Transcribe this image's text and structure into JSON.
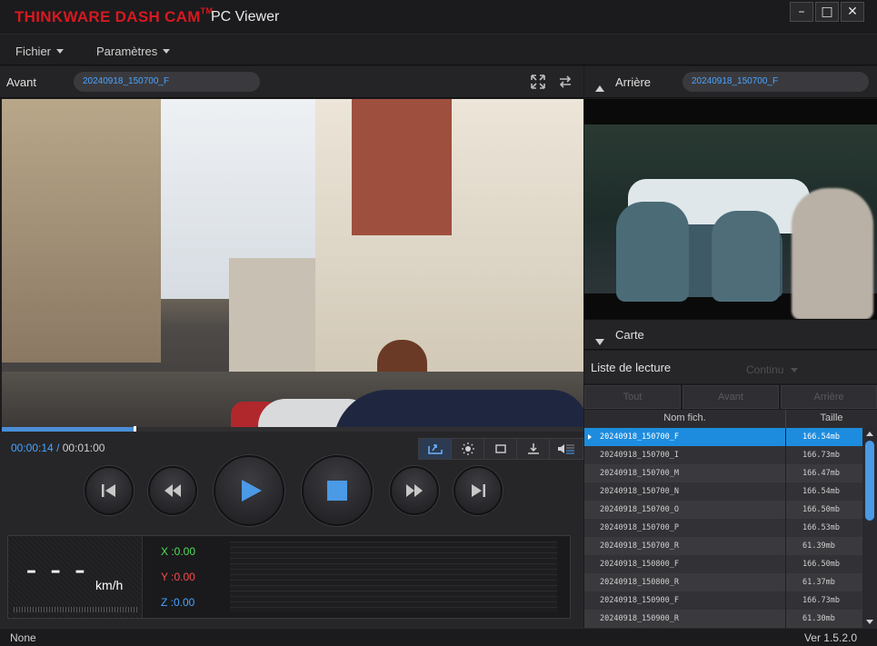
{
  "window": {
    "brand": "THINKWARE DASH CAM",
    "brand_tm": "TM",
    "title": "PC Viewer",
    "minimize": "–",
    "maximize": "□",
    "close": "✕"
  },
  "menu": {
    "file": "Fichier",
    "settings": "Paramètres"
  },
  "front": {
    "label": "Avant",
    "filename": "20240918_150700_F",
    "progress": 0.23
  },
  "rear": {
    "label": "Arrière",
    "filename": "20240918_150700_F"
  },
  "map": {
    "label": "Carte"
  },
  "player": {
    "current_time": "00:00:14",
    "separator": "/",
    "total_time": "00:01:00",
    "speed_value": "– – –",
    "speed_unit": "km/h",
    "g_x": "X :0.00",
    "g_y": "Y :0.00",
    "g_z": "Z :0.00"
  },
  "playlist": {
    "title": "Liste de lecture",
    "mode": "Continu",
    "filters": [
      "Tout",
      "Avant",
      "Arrière"
    ],
    "columns": {
      "name": "Nom fich.",
      "size": "Taille"
    },
    "rows": [
      {
        "name": "20240918_150700_F",
        "size": "166.54mb",
        "selected": true
      },
      {
        "name": "20240918_150700_I",
        "size": "166.73mb"
      },
      {
        "name": "20240918_150700_M",
        "size": "166.47mb"
      },
      {
        "name": "20240918_150700_N",
        "size": "166.54mb"
      },
      {
        "name": "20240918_150700_O",
        "size": "166.50mb"
      },
      {
        "name": "20240918_150700_P",
        "size": "166.53mb"
      },
      {
        "name": "20240918_150700_R",
        "size": "61.39mb"
      },
      {
        "name": "20240918_150800_F",
        "size": "166.50mb"
      },
      {
        "name": "20240918_150800_R",
        "size": "61.37mb"
      },
      {
        "name": "20240918_150900_F",
        "size": "166.73mb"
      },
      {
        "name": "20240918_150900_R",
        "size": "61.30mb"
      }
    ]
  },
  "status": {
    "left": "None",
    "version": "Ver 1.5.2.0"
  },
  "colors": {
    "brand": "#d71920",
    "accent": "#4aa3ff",
    "selected_row": "#1e8cde",
    "g_x": "#4ee05a",
    "g_y": "#ff4a4a",
    "g_z": "#4aa3ff"
  }
}
